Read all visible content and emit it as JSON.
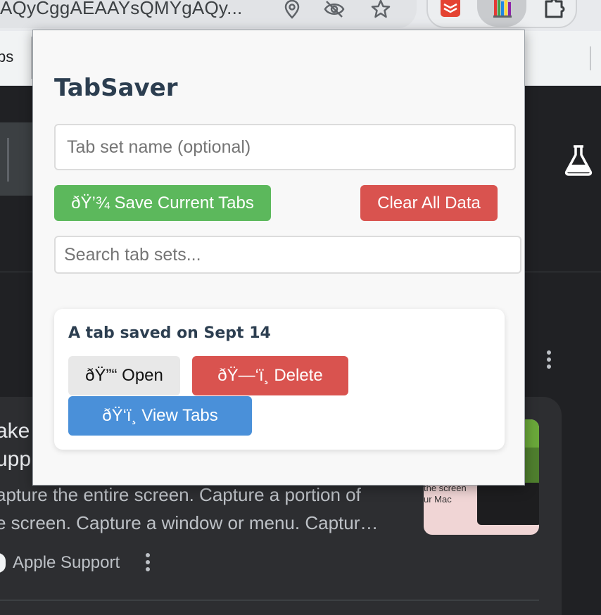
{
  "browser": {
    "url_text": "AQyCggAEAAYsQMYgAQy...",
    "bookmarks_partial": "bs"
  },
  "colors": {
    "save_button": "#5cb85c",
    "delete_button": "#d9534f",
    "view_button": "#4a90d9",
    "title_text": "#2c3e50"
  },
  "popup": {
    "title": "TabSaver",
    "name_input_placeholder": "Tab set name (optional)",
    "save_label": "ðŸ’¾ Save Current Tabs",
    "clear_label": "Clear All Data",
    "search_placeholder": "Search tab sets...",
    "tab_sets": [
      {
        "name": "A tab saved on Sept 14",
        "open_label": "ðŸ”“ Open",
        "delete_label": "ðŸ—‘ï¸ Delete",
        "view_label": "ðŸ‘ï¸ View Tabs"
      }
    ]
  },
  "page": {
    "result_title_line1": "ake",
    "result_title_line2": "upp",
    "snippet_line1": "apture the entire screen. Capture a portion of",
    "snippet_line2": "e screen. Capture a window or menu. Captur…",
    "source_name": "Apple Support",
    "thumbnail_text": "the screen\nur Mac"
  }
}
